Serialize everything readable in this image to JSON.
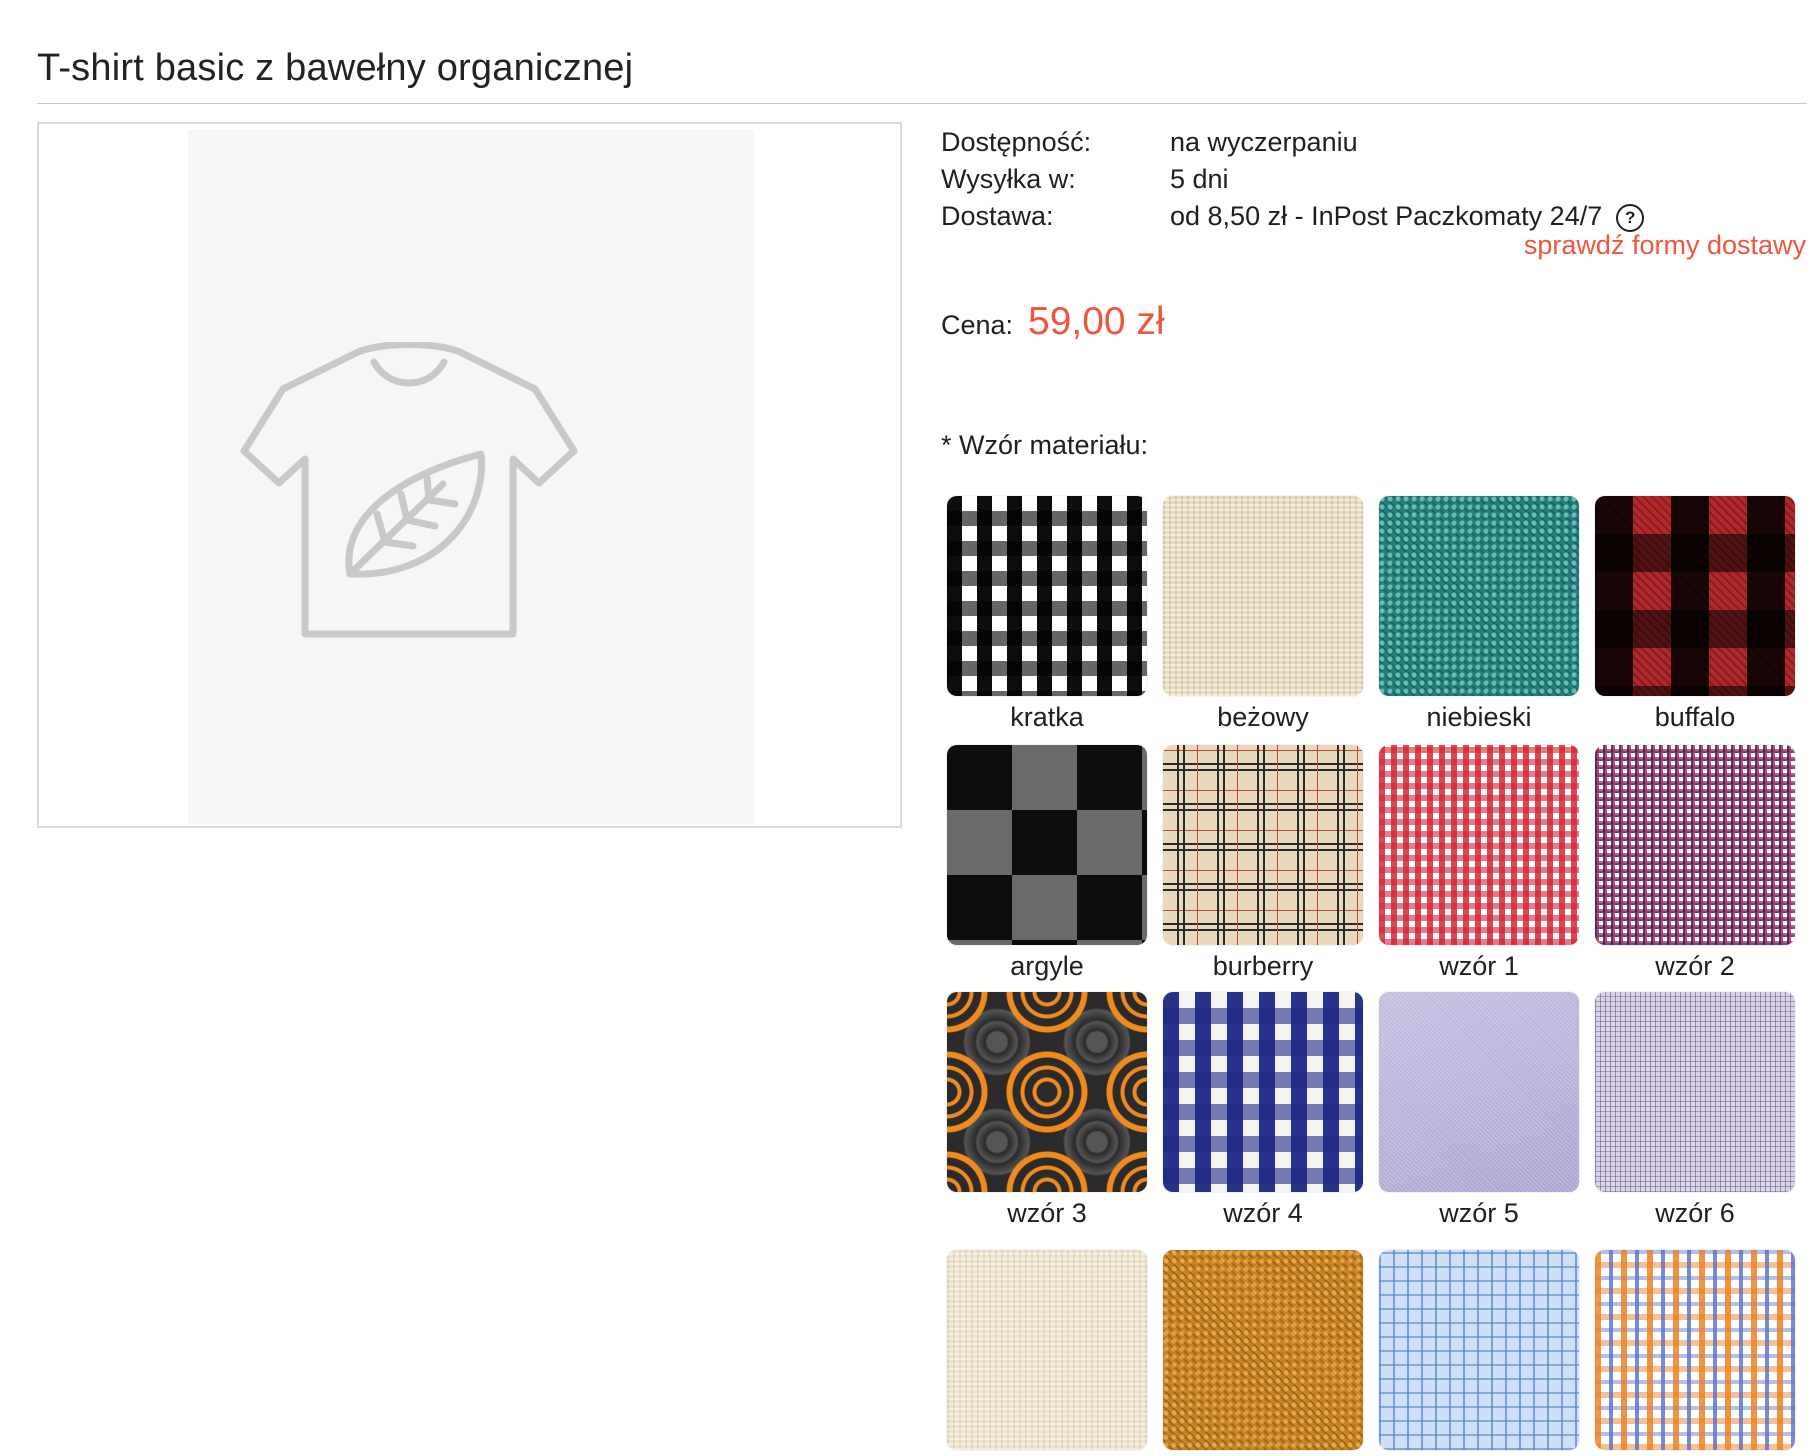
{
  "product": {
    "title": "T-shirt basic z bawełny organicznej",
    "image_icon": "tshirt-leaf-icon"
  },
  "info": {
    "availability_label": "Dostępność:",
    "availability_value": "na wyczerpaniu",
    "shipping_label": "Wysyłka w:",
    "shipping_value": "5 dni",
    "delivery_label": "Dostawa:",
    "delivery_value": "od 8,50 zł - InPost Paczkomaty 24/7",
    "help_icon": "question-circle-icon",
    "help_glyph": "?",
    "delivery_link": "sprawdź formy dostawy"
  },
  "price": {
    "label": "Cena:",
    "value": "59,00 zł",
    "color": "#f0553d"
  },
  "patterns": {
    "label": "* Wzór materiału:",
    "items": [
      {
        "name": "kratka"
      },
      {
        "name": "beżowy"
      },
      {
        "name": "niebieski"
      },
      {
        "name": "buffalo"
      },
      {
        "name": "argyle"
      },
      {
        "name": "burberry"
      },
      {
        "name": "wzór 1"
      },
      {
        "name": "wzór 2"
      },
      {
        "name": "wzór 3"
      },
      {
        "name": "wzór 4"
      },
      {
        "name": "wzór 5"
      },
      {
        "name": "wzór 6"
      },
      {
        "name": ""
      },
      {
        "name": ""
      },
      {
        "name": ""
      },
      {
        "name": ""
      }
    ]
  }
}
